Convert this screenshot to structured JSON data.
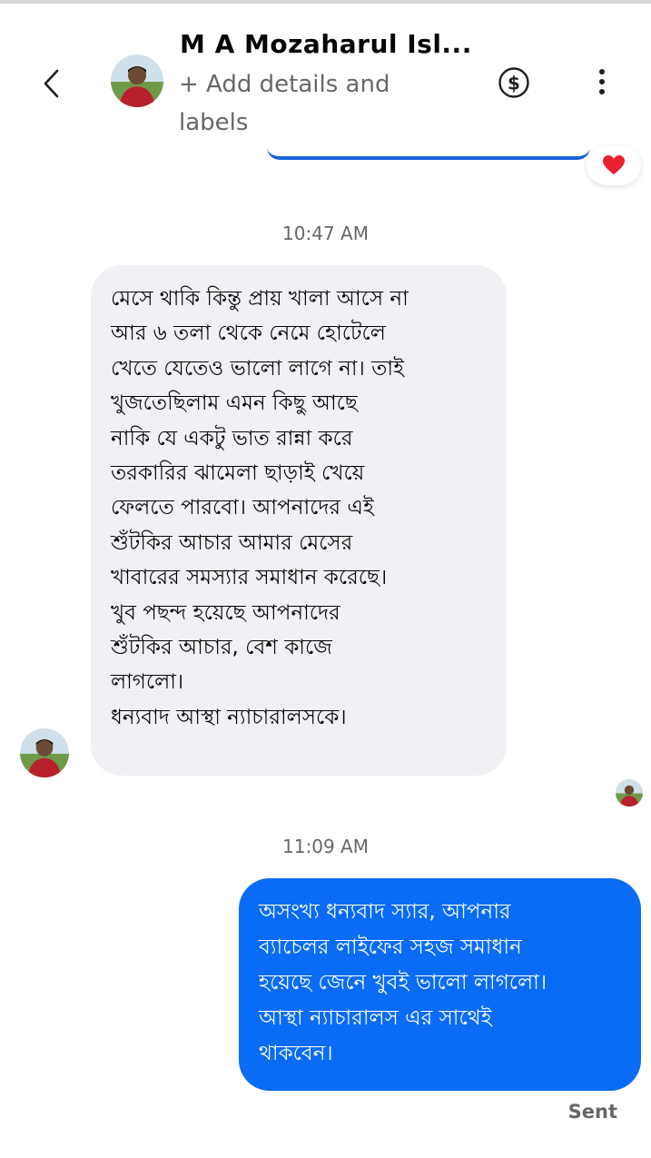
{
  "header": {
    "contact_name": "M A Mozaharul Isl...",
    "add_details": "+ Add details and labels",
    "back_icon": "chevron-left-icon",
    "payment_icon": "dollar-circle-icon",
    "more_icon": "more-vertical-icon"
  },
  "thread": {
    "previous_reaction": "❤️",
    "messages": [
      {
        "timestamp": "10:47 AM",
        "direction": "incoming",
        "text": "মেসে থাকি কিন্তু প্রায় খালা আসে না\nআর ৬ তলা থেকে নেমে হোটেলে\nখেতে যেতেও ভালো লাগে না। তাই\nখুজতেছিলাম এমন কিছু আছে\nনাকি যে একটু ভাত রান্না করে\nতরকারির ঝামেলা ছাড়াই খেয়ে\nফেলতে পারবো। আপনাদের এই\nশুঁটকির আচার আমার মেসের\nখাবারের সমস্যার সমাধান করেছে।\nখুব পছন্দ হয়েছে আপনাদের\nশুঁটকির আচার, বেশ কাজে\nলাগলো।\nধন্যবাদ আস্থা ন্যাচারালসকে।"
      },
      {
        "timestamp": "11:09 AM",
        "direction": "outgoing",
        "text": "অসংখ্য ধন্যবাদ স্যার, আপনার\nব্যাচেলর লাইফের সহজ সমাধান\nহয়েছে জেনে খুবই ভালো লাগলো।\nআস্থা ন্যাচারালস এর সাথেই\nথাকবেন।",
        "status": "Sent"
      }
    ]
  },
  "colors": {
    "outgoing_bubble": "#0a6cf5",
    "incoming_bubble": "#eff1f4",
    "secondary_text": "#65676b",
    "reaction_heart": "#e8202f"
  }
}
